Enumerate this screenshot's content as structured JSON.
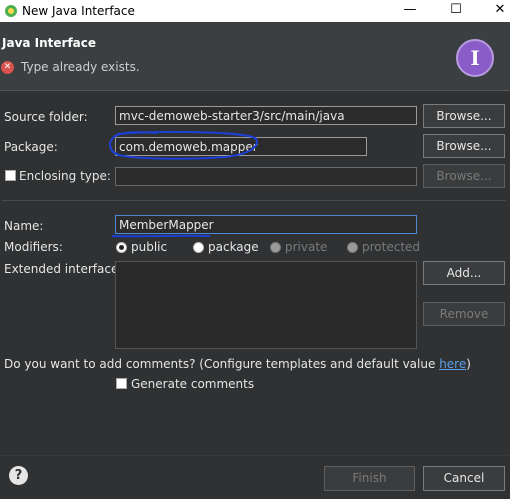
{
  "window": {
    "title": "New Java Interface",
    "minimize": "—",
    "maximize": "☐",
    "close": "✕"
  },
  "header": {
    "title": "Java Interface",
    "error": "Type already exists."
  },
  "form": {
    "source_folder_label": "Source folder:",
    "source_folder_value": "mvc-demoweb-starter3/src/main/java",
    "package_label": "Package:",
    "package_value": "com.demoweb.mapper",
    "enclosing_type_label": "Enclosing type:",
    "enclosing_type_value": "",
    "name_label": "Name:",
    "name_value": "MemberMapper",
    "modifiers_label": "Modifiers:",
    "modifier_public": "public",
    "modifier_package": "package",
    "modifier_private": "private",
    "modifier_protected": "protected",
    "extended_label": "Extended interfaces:",
    "comments_question": "Do you want to add comments? (Configure templates and default value ",
    "comments_link": "here",
    "comments_close": ")",
    "generate_comments": "Generate comments"
  },
  "buttons": {
    "browse": "Browse...",
    "add": "Add...",
    "remove": "Remove",
    "finish": "Finish",
    "cancel": "Cancel",
    "help": "?"
  }
}
